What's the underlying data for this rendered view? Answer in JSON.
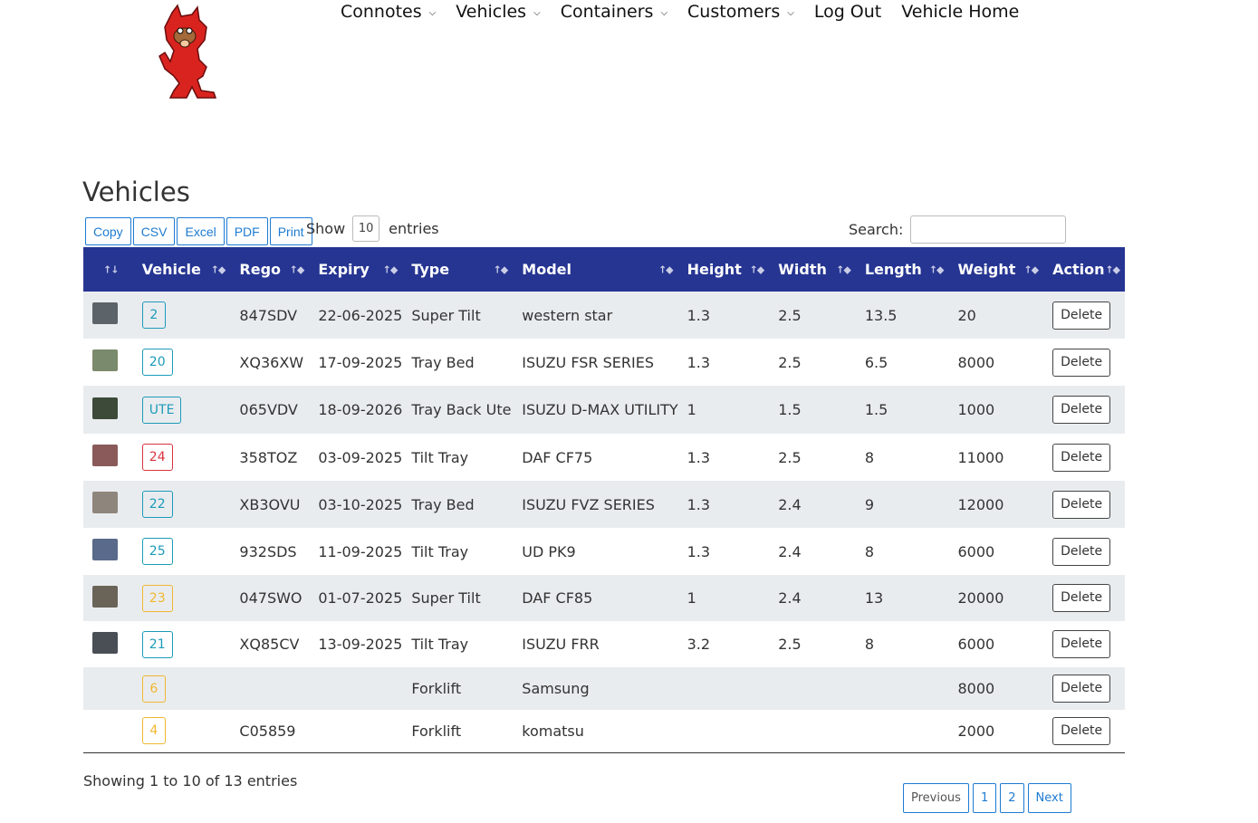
{
  "nav": {
    "items": [
      {
        "label": "Connotes",
        "dropdown": true
      },
      {
        "label": "Vehicles",
        "dropdown": true
      },
      {
        "label": "Containers",
        "dropdown": true
      },
      {
        "label": "Customers",
        "dropdown": true
      },
      {
        "label": "Log Out",
        "dropdown": false
      },
      {
        "label": "Vehicle Home",
        "dropdown": false
      }
    ]
  },
  "page": {
    "title": "Vehicles"
  },
  "export_buttons": [
    "Copy",
    "CSV",
    "Excel",
    "PDF",
    "Print"
  ],
  "length": {
    "prefix": "Show",
    "value": "10",
    "suffix": "entries"
  },
  "search": {
    "label": "Search:",
    "value": ""
  },
  "table": {
    "columns": [
      "",
      "Vehicle",
      "Rego",
      "Expiry",
      "Type",
      "Model",
      "Height",
      "Width",
      "Length",
      "Weight",
      "Action"
    ],
    "rows": [
      {
        "thumb": "#5c646a",
        "vehicle": "2",
        "vcolor": "blue",
        "rego": "847SDV",
        "expiry": "22-06-2025",
        "type": "Super Tilt",
        "model": "western star",
        "height": "1.3",
        "width": "2.5",
        "length": "13.5",
        "weight": "20",
        "action": "Delete"
      },
      {
        "thumb": "#7a8a6c",
        "vehicle": "20",
        "vcolor": "blue",
        "rego": "XQ36XW",
        "expiry": "17-09-2025",
        "type": "Tray Bed",
        "model": "ISUZU FSR SERIES",
        "height": "1.3",
        "width": "2.5",
        "length": "6.5",
        "weight": "8000",
        "action": "Delete"
      },
      {
        "thumb": "#3d4a3a",
        "vehicle": "UTE",
        "vcolor": "blue",
        "rego": "065VDV",
        "expiry": "18-09-2026",
        "type": "Tray Back Ute",
        "model": "ISUZU D-MAX UTILITY",
        "height": "1",
        "width": "1.5",
        "length": "1.5",
        "weight": "1000",
        "action": "Delete"
      },
      {
        "thumb": "#8a5a5a",
        "vehicle": "24",
        "vcolor": "red",
        "rego": "358TOZ",
        "expiry": "03-09-2025",
        "type": "Tilt Tray",
        "model": "DAF CF75",
        "height": "1.3",
        "width": "2.5",
        "length": "8",
        "weight": "11000",
        "action": "Delete"
      },
      {
        "thumb": "#8e857c",
        "vehicle": "22",
        "vcolor": "blue",
        "rego": "XB3OVU",
        "expiry": "03-10-2025",
        "type": "Tray Bed",
        "model": "ISUZU FVZ SERIES",
        "height": "1.3",
        "width": "2.4",
        "length": "9",
        "weight": "12000",
        "action": "Delete"
      },
      {
        "thumb": "#5a6a8a",
        "vehicle": "25",
        "vcolor": "blue",
        "rego": "932SDS",
        "expiry": "11-09-2025",
        "type": "Tilt Tray",
        "model": "UD PK9",
        "height": "1.3",
        "width": "2.4",
        "length": "8",
        "weight": "6000",
        "action": "Delete"
      },
      {
        "thumb": "#6a6458",
        "vehicle": "23",
        "vcolor": "yellow",
        "rego": "047SWO",
        "expiry": "01-07-2025",
        "type": "Super Tilt",
        "model": "DAF CF85",
        "height": "1",
        "width": "2.4",
        "length": "13",
        "weight": "20000",
        "action": "Delete"
      },
      {
        "thumb": "#4a4e55",
        "vehicle": "21",
        "vcolor": "blue",
        "rego": "XQ85CV",
        "expiry": "13-09-2025",
        "type": "Tilt Tray",
        "model": "ISUZU FRR",
        "height": "3.2",
        "width": "2.5",
        "length": "8",
        "weight": "6000",
        "action": "Delete"
      },
      {
        "thumb": "",
        "vehicle": "6",
        "vcolor": "yellow",
        "rego": "",
        "expiry": "",
        "type": "Forklift",
        "model": "Samsung",
        "height": "",
        "width": "",
        "length": "",
        "weight": "8000",
        "action": "Delete"
      },
      {
        "thumb": "",
        "vehicle": "4",
        "vcolor": "yellow",
        "rego": "C05859",
        "expiry": "",
        "type": "Forklift",
        "model": "komatsu",
        "height": "",
        "width": "",
        "length": "",
        "weight": "2000",
        "action": "Delete"
      }
    ]
  },
  "info": "Showing 1 to 10 of 13 entries",
  "pagination": [
    "Previous",
    "1",
    "2",
    "Next"
  ]
}
